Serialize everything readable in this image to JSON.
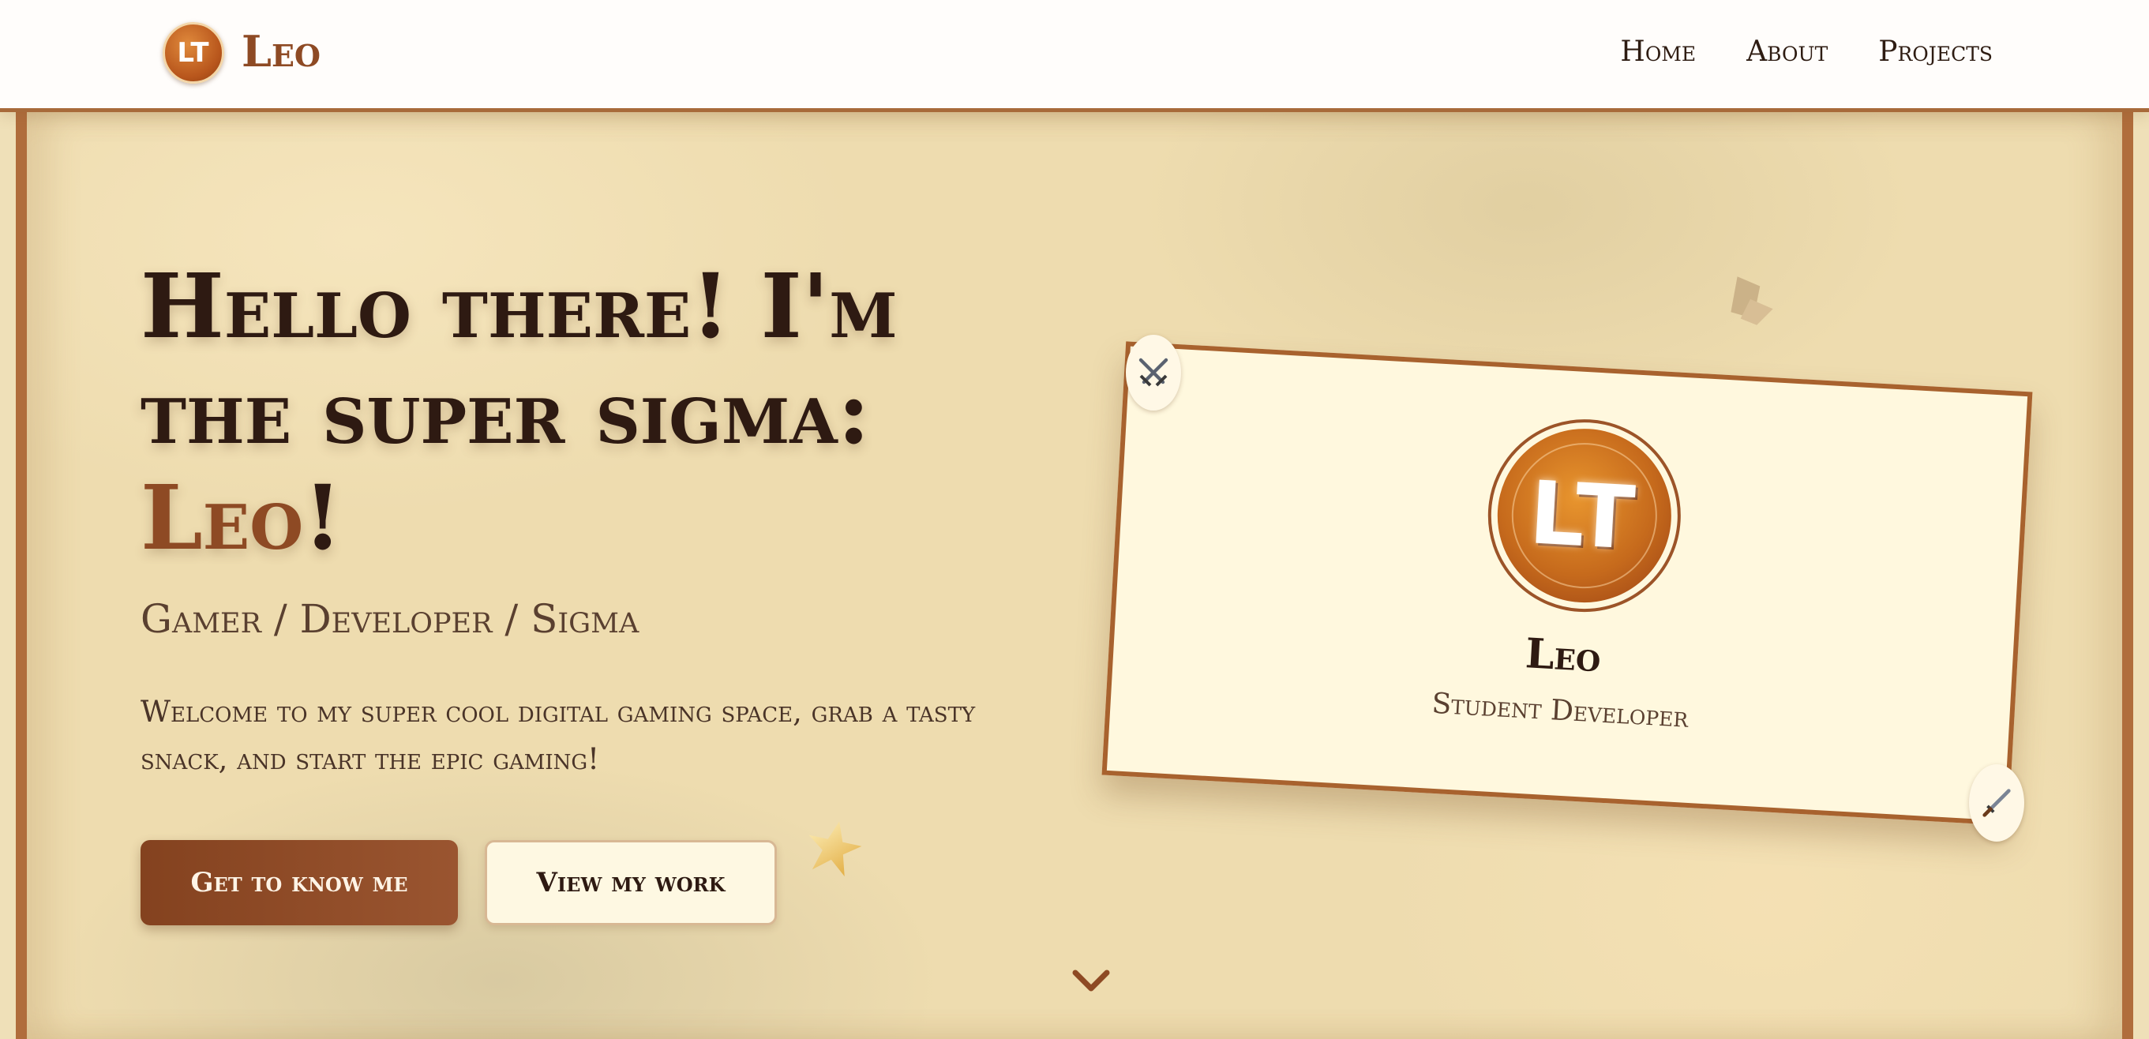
{
  "nav": {
    "logo_text": "LT",
    "brand": "Leo",
    "links": [
      "Home",
      "About",
      "Projects"
    ]
  },
  "hero": {
    "title_line1": "Hello there! I'm",
    "title_line2": "the super sigma:",
    "title_name": "Leo",
    "title_suffix": "!",
    "subtitle": "Gamer / Developer / Sigma",
    "description": "Welcome to my super cool digital gaming space, grab a tasty snack, and start the epic gaming!",
    "primary_button": "Get to know me",
    "secondary_button": "View my work"
  },
  "card": {
    "avatar_text": "LT",
    "name": "Leo",
    "role": "Student Developer"
  },
  "icons": {
    "swords": "crossed-swords-icon",
    "dagger": "dagger-icon",
    "star": "star-icon",
    "chevron": "chevron-down-icon",
    "gem": "gem-icon"
  },
  "colors": {
    "brand": "#8e4a24",
    "accent_border": "#a8622e",
    "background": "#eedcaf",
    "card_bg": "#fff8de",
    "text_dark": "#2e1a12"
  }
}
